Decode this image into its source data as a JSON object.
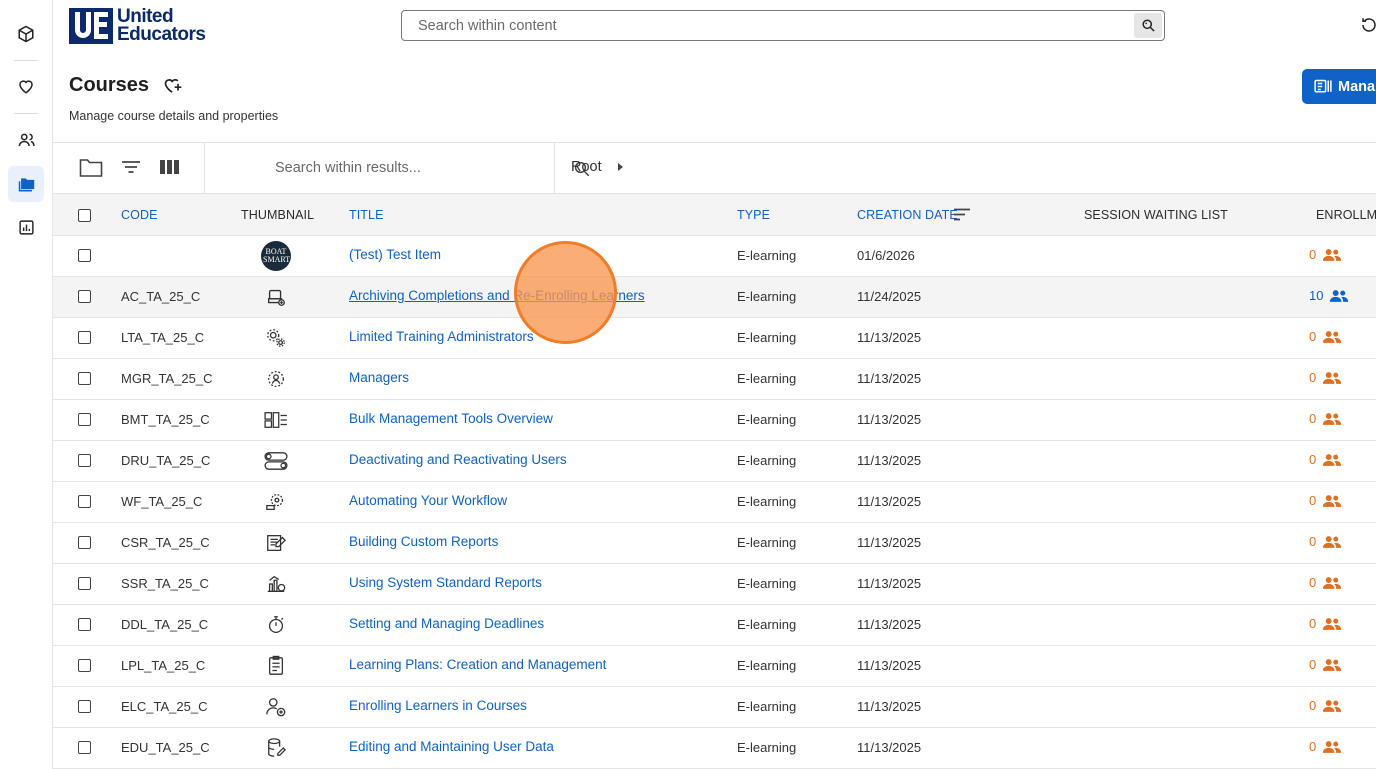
{
  "app": {
    "logo_line1": "United",
    "logo_line2": "Educators",
    "logo_mark": "UE"
  },
  "header": {
    "search_placeholder": "Search within content"
  },
  "rail": {
    "items": [
      {
        "name": "cube-icon"
      },
      {
        "name": "heart-icon"
      },
      {
        "name": "users-icon"
      },
      {
        "name": "folders-icon",
        "active": true
      },
      {
        "name": "reports-icon"
      }
    ]
  },
  "page": {
    "title": "Courses",
    "subtitle": "Manage course details and properties",
    "manage_label": "Mana"
  },
  "toolbar": {
    "search_placeholder": "Search within results...",
    "breadcrumb_root": "Root"
  },
  "table": {
    "headers": {
      "code": "CODE",
      "thumbnail": "THUMBNAIL",
      "title": "TITLE",
      "type": "TYPE",
      "creation_date": "CREATION DATE",
      "waiting_list": "SESSION WAITING LIST",
      "enrollments": "ENROLLME"
    },
    "rows": [
      {
        "code": "",
        "title": "(Test) Test Item",
        "type": "E-learning",
        "date": "01/6/2026",
        "enrolled": "0",
        "thumb": "boat-smart-logo",
        "thumb_text": "BOAT SMART"
      },
      {
        "code": "AC_TA_25_C",
        "title": "Archiving Completions and Re-Enrolling Learners",
        "type": "E-learning",
        "date": "11/24/2025",
        "enrolled": "10",
        "thumb": "archive-icon"
      },
      {
        "code": "LTA_TA_25_C",
        "title": "Limited Training Administrators",
        "type": "E-learning",
        "date": "11/13/2025",
        "enrolled": "0",
        "thumb": "gears-icon"
      },
      {
        "code": "MGR_TA_25_C",
        "title": "Managers",
        "type": "E-learning",
        "date": "11/13/2025",
        "enrolled": "0",
        "thumb": "manager-icon"
      },
      {
        "code": "BMT_TA_25_C",
        "title": "Bulk Management Tools Overview",
        "type": "E-learning",
        "date": "11/13/2025",
        "enrolled": "0",
        "thumb": "tools-icon"
      },
      {
        "code": "DRU_TA_25_C",
        "title": "Deactivating and Reactivating Users",
        "type": "E-learning",
        "date": "11/13/2025",
        "enrolled": "0",
        "thumb": "toggle-icon"
      },
      {
        "code": "WF_TA_25_C",
        "title": "Automating Your Workflow",
        "type": "E-learning",
        "date": "11/13/2025",
        "enrolled": "0",
        "thumb": "workflow-icon"
      },
      {
        "code": "CSR_TA_25_C",
        "title": "Building Custom Reports",
        "type": "E-learning",
        "date": "11/13/2025",
        "enrolled": "0",
        "thumb": "report-edit-icon"
      },
      {
        "code": "SSR_TA_25_C",
        "title": "Using System Standard Reports",
        "type": "E-learning",
        "date": "11/13/2025",
        "enrolled": "0",
        "thumb": "chart-icon"
      },
      {
        "code": "DDL_TA_25_C",
        "title": "Setting and Managing Deadlines",
        "type": "E-learning",
        "date": "11/13/2025",
        "enrolled": "0",
        "thumb": "stopwatch-icon"
      },
      {
        "code": "LPL_TA_25_C",
        "title": "Learning Plans: Creation and Management",
        "type": "E-learning",
        "date": "11/13/2025",
        "enrolled": "0",
        "thumb": "clipboard-icon"
      },
      {
        "code": "ELC_TA_25_C",
        "title": "Enrolling Learners in Courses",
        "type": "E-learning",
        "date": "11/13/2025",
        "enrolled": "0",
        "thumb": "user-add-icon"
      },
      {
        "code": "EDU_TA_25_C",
        "title": "Editing and Maintaining User Data",
        "type": "E-learning",
        "date": "11/13/2025",
        "enrolled": "0",
        "thumb": "database-icon"
      }
    ]
  },
  "colors": {
    "accent": "#0f62c7",
    "enroll_zero": "#e0701f",
    "enroll_active": "#0f62c7"
  }
}
